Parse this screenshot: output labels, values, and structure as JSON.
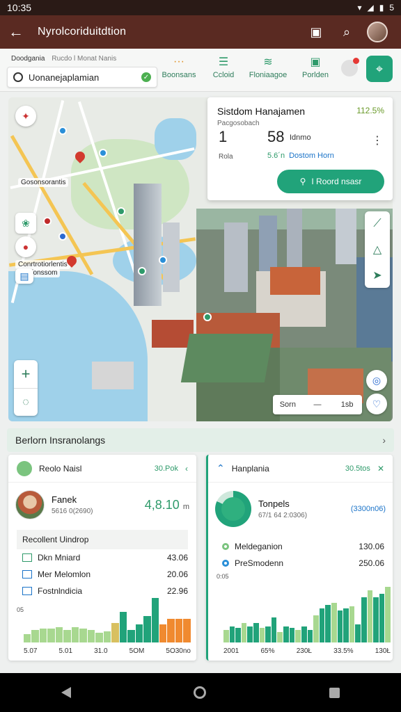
{
  "status": {
    "time": "10:35",
    "battery": "5"
  },
  "appbar": {
    "back_icon": "arrow-left-icon",
    "title": "Nyrolcoriduitdtion"
  },
  "toolbar": {
    "search": {
      "label_primary": "Doodgania",
      "label_secondary": "Rucdo l Monat Nanis",
      "value": "Uonanejaplamian"
    },
    "tools": [
      {
        "label": "Boonsans",
        "icon": "dots-icon"
      },
      {
        "label": "Ccloid",
        "icon": "list-icon"
      },
      {
        "label": "Floniaagoe",
        "icon": "layers-icon"
      },
      {
        "label": "Porlden",
        "icon": "camera-icon"
      }
    ]
  },
  "map": {
    "tag_top": "Gosonsorantis",
    "tag_mid": "Conrtrotiorlentis",
    "tag_mid2": "Bfonssom",
    "zoom_in": "+",
    "scale": {
      "left": "Sorn",
      "sep": "—",
      "right": "1sb"
    }
  },
  "infocard": {
    "title": "Sistdom Hanajamen",
    "pct": "112.5%",
    "sub": "Pacgosobach",
    "stat1": "1",
    "stat1_label": "Rola",
    "stat2": "58",
    "stat2_unit": "Idnmo",
    "stat2_label_a": "5.6´n",
    "stat2_label_b": "Dostom Horn",
    "cta": "I Roord nsasr"
  },
  "section": {
    "title": "Berlorn Insranolangs"
  },
  "card_left": {
    "title": "Reolo Naisl",
    "head_value": "30.Pok",
    "hero_name": "Fanek",
    "hero_sub": "5616 0(2690)",
    "hero_value": "4,8.10",
    "hero_unit": "m",
    "subhead": "Recollent Uindrop",
    "rows": [
      {
        "label": "Dkn Mniard",
        "value": "43.06"
      },
      {
        "label": "Mer Melomlon",
        "value": "20.06"
      },
      {
        "label": "Fostnlndicia",
        "value": "22.96"
      }
    ],
    "ytick": "05",
    "x_labels": [
      "5.07",
      "5.01",
      "31.0",
      "5OM",
      "5O30no"
    ]
  },
  "card_right": {
    "title": "Hanplania",
    "head_value": "30.5tos",
    "hero_name": "Tonpels",
    "hero_sub": "67/1 64 2:0306)",
    "hero_alt": "(3300n06)",
    "rows": [
      {
        "label": "Meldeganion",
        "value": "130.06"
      },
      {
        "label": "PreSmodenn",
        "value": "250.06"
      }
    ],
    "ytick": "0:05",
    "x_labels": [
      "2001",
      "65%",
      "230Ł",
      "33.5%",
      "130Ł"
    ]
  },
  "colors": {
    "accent": "#21a37a",
    "appbar": "#5a2a22",
    "orange": "#f08a30",
    "light_green": "#a8d890"
  },
  "chart_data": [
    {
      "type": "bar",
      "title": "",
      "xlabel": "",
      "ylabel": "",
      "categories": [
        "5.07",
        "5.01",
        "31.0",
        "5OM",
        "5O30no"
      ],
      "values": [
        12,
        18,
        20,
        20,
        22,
        18,
        22,
        20,
        18,
        14,
        16,
        28,
        44,
        18,
        26,
        38,
        64,
        26,
        34,
        34,
        34
      ]
    },
    {
      "type": "bar",
      "title": "",
      "xlabel": "",
      "ylabel": "",
      "categories": [
        "2001",
        "65%",
        "230Ł",
        "33.5%",
        "130Ł"
      ],
      "values": [
        14,
        18,
        16,
        22,
        18,
        22,
        16,
        18,
        28,
        12,
        18,
        16,
        14,
        18,
        14,
        30,
        38,
        42,
        44,
        36,
        38,
        40,
        20,
        50,
        58,
        50,
        54,
        62
      ]
    }
  ]
}
